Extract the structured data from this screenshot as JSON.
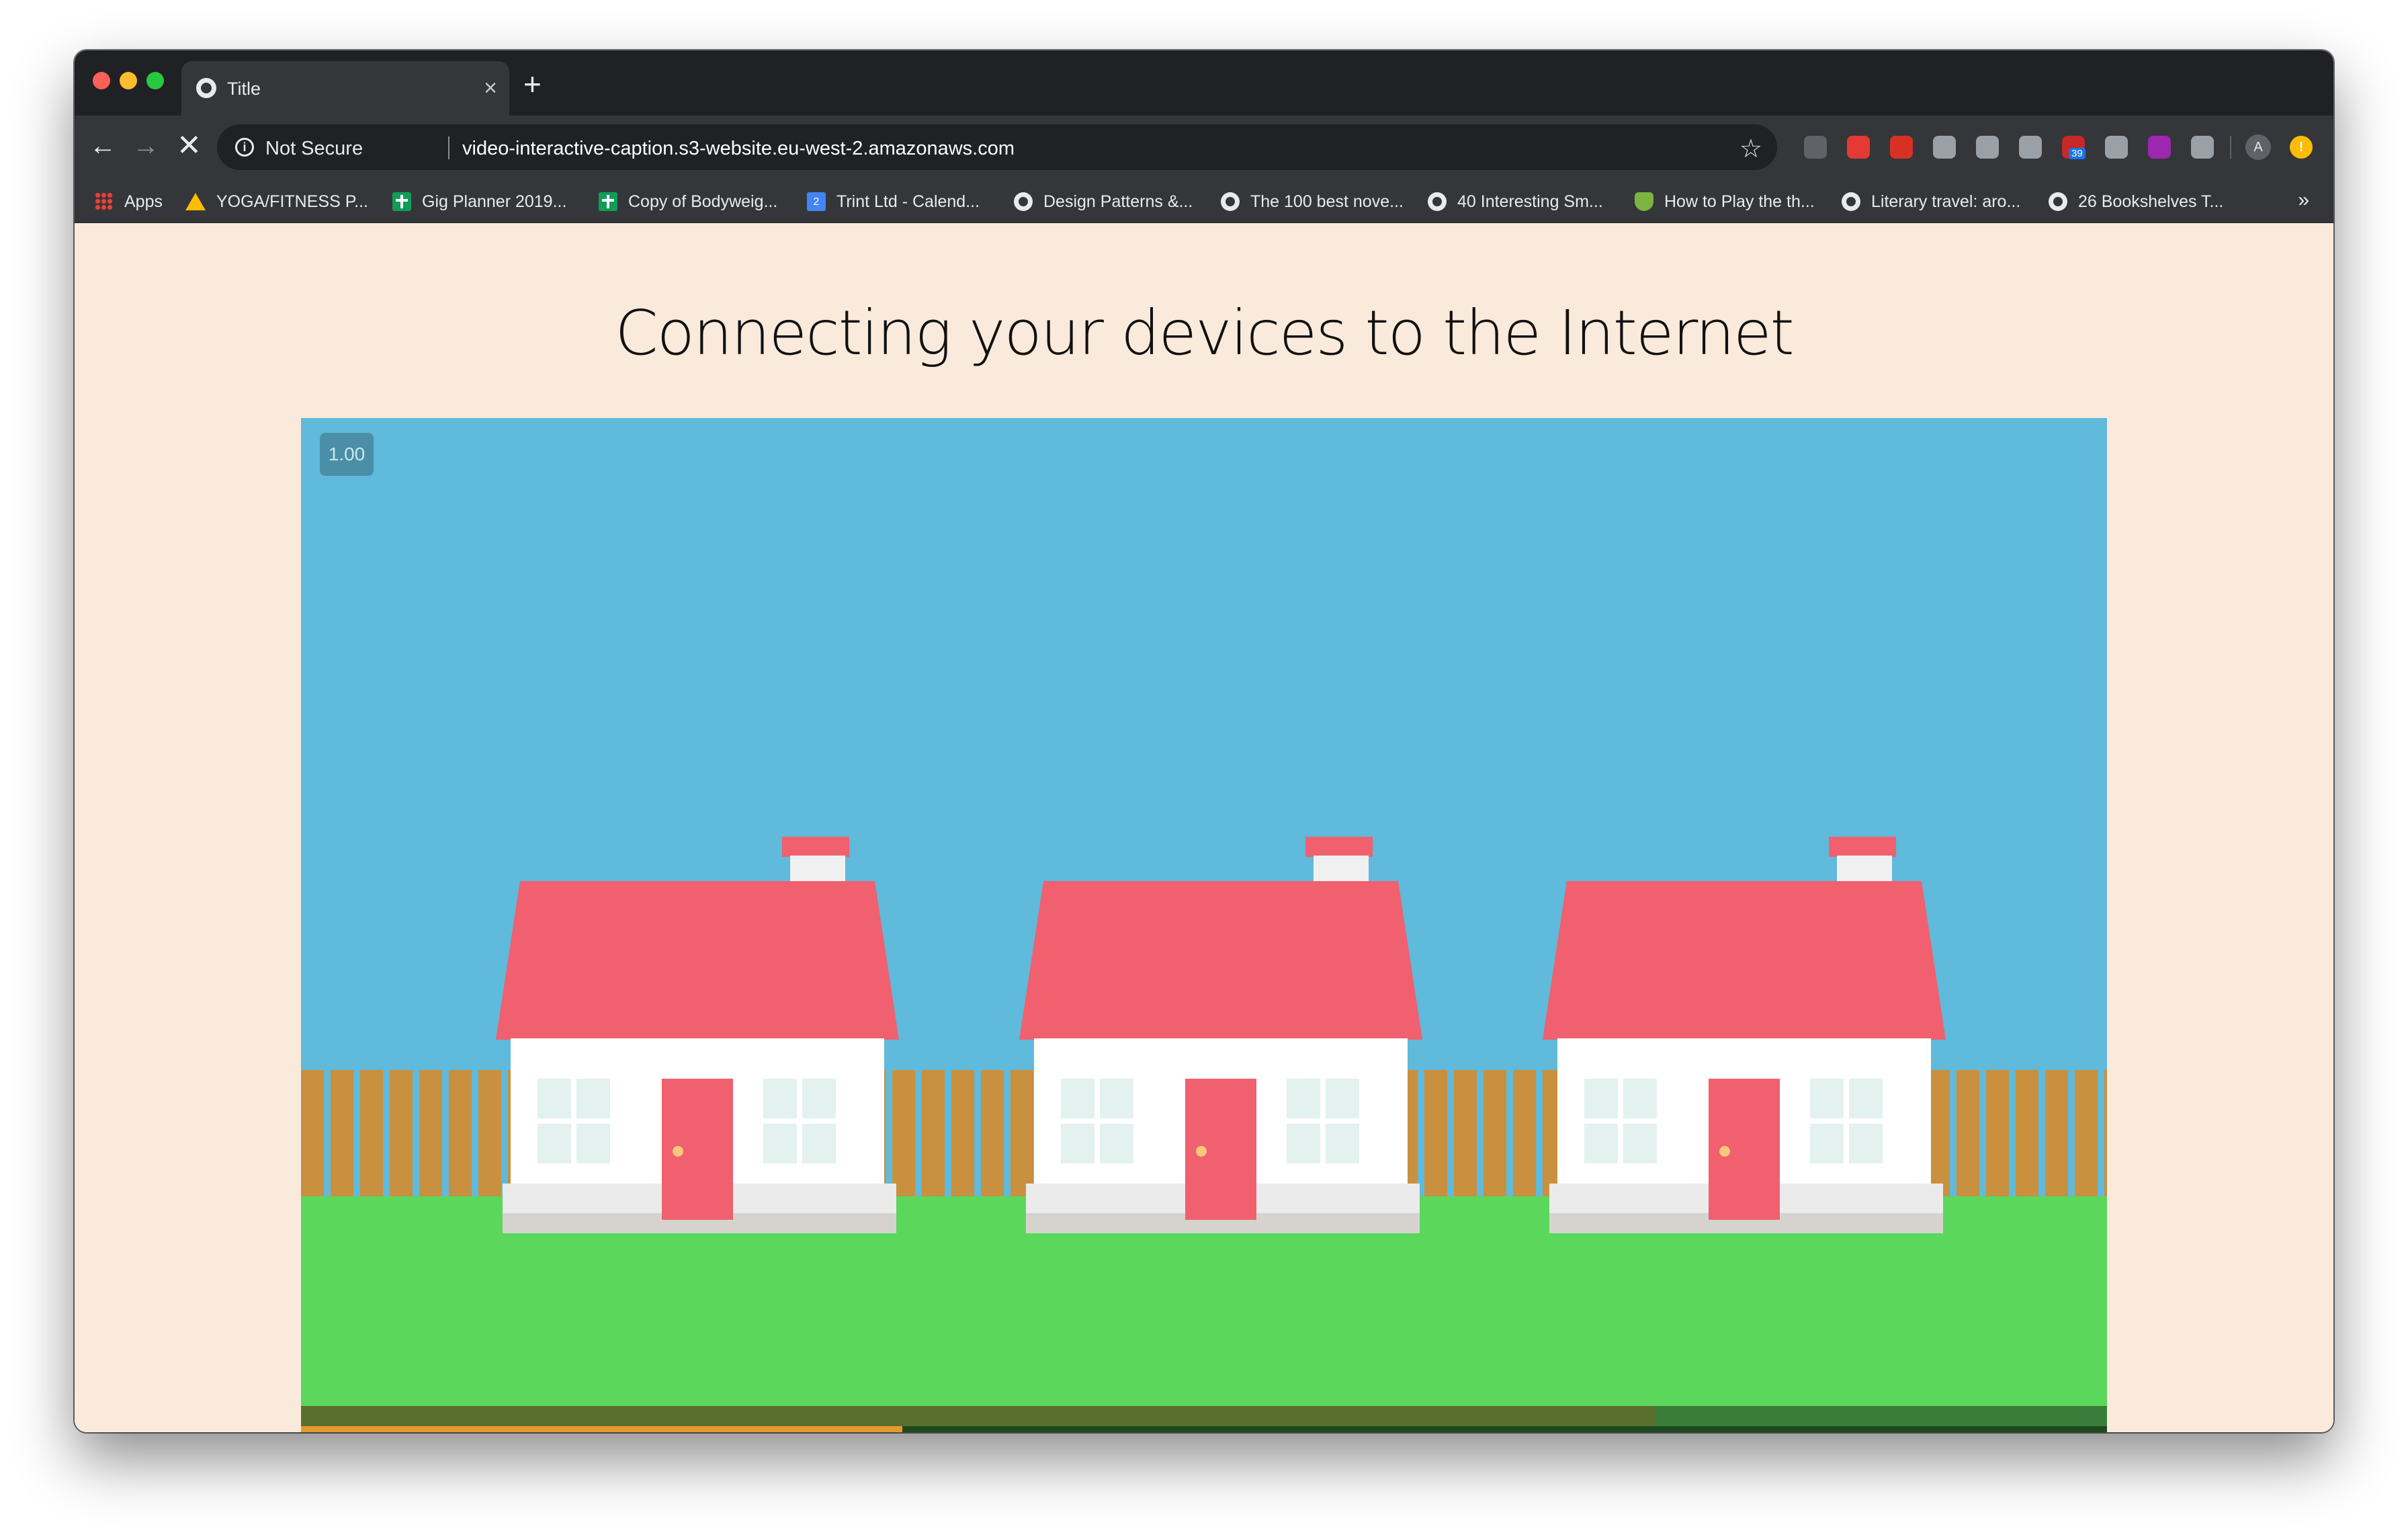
{
  "browser": {
    "tab_title": "Title",
    "tab_close": "×",
    "new_tab": "+",
    "nav": {
      "back": "←",
      "forward": "→",
      "stop": "✕"
    },
    "security_label": "Not Secure",
    "info_glyph": "i",
    "url": "video-interactive-caption.s3-website.eu-west-2.amazonaws.com",
    "bookmark_star": "☆",
    "profile_initial": "A",
    "update_glyph": "!",
    "extensions": [
      {
        "icon": "ellipsis-extension-icon",
        "color": "#5f6368"
      },
      {
        "icon": "youtube-extension-icon",
        "color": "#e53935"
      },
      {
        "icon": "stop-extension-icon",
        "color": "#d93025"
      },
      {
        "icon": "robot-extension-icon",
        "color": "#9aa0a6"
      },
      {
        "icon": "react-extension-icon",
        "color": "#9aa0a6"
      },
      {
        "icon": "grammar-extension-icon",
        "color": "#9aa0a6"
      },
      {
        "icon": "calendar-badge-extension-icon",
        "color": "#c62828",
        "badge": "39"
      },
      {
        "icon": "capture-extension-icon",
        "color": "#9aa0a6"
      },
      {
        "icon": "hashtag-extension-icon",
        "color": "#9c27b0"
      },
      {
        "icon": "info-extension-icon",
        "color": "#9aa0a6"
      }
    ],
    "bookmarks": [
      {
        "icon": "apps",
        "label": "Apps"
      },
      {
        "icon": "drive",
        "label": "YOGA/FITNESS P..."
      },
      {
        "icon": "sheets",
        "label": "Gig Planner 2019..."
      },
      {
        "icon": "sheets",
        "label": "Copy of Bodyweig..."
      },
      {
        "icon": "calendar",
        "label": "Trint Ltd - Calend..."
      },
      {
        "icon": "globe",
        "label": "Design Patterns &..."
      },
      {
        "icon": "globe",
        "label": "The 100 best nove..."
      },
      {
        "icon": "globe",
        "label": "40 Interesting Sm..."
      },
      {
        "icon": "green-shield",
        "label": "How to Play the th..."
      },
      {
        "icon": "globe",
        "label": "Literary travel: aro..."
      },
      {
        "icon": "globe",
        "label": "26 Bookshelves T..."
      }
    ],
    "bookmarks_overflow": "»"
  },
  "page": {
    "title": "Connecting your devices to the Internet",
    "video": {
      "playback_rate": "1.00",
      "progress_fraction": 0.333,
      "buffered_fraction": 0.75,
      "colors": {
        "sky": "#5fbadb",
        "grass": "#5bd75c",
        "roof": "#f0606f",
        "fence": "#c8903f",
        "progress": "#e59a2b"
      }
    }
  }
}
